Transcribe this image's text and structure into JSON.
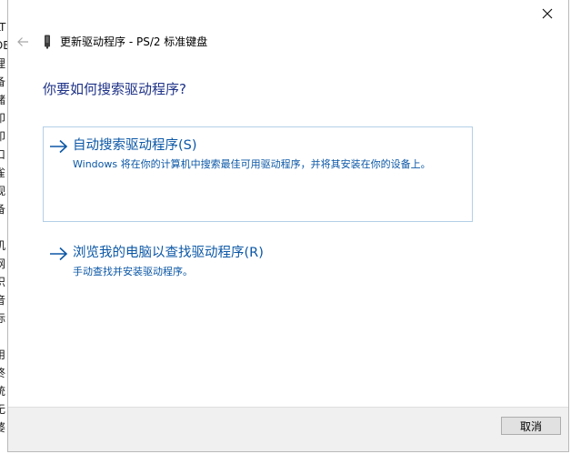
{
  "background_window": {
    "edge_chars": [
      "LT",
      "DE",
      "理",
      "备",
      "储",
      "印",
      "印",
      "口",
      "雀",
      "视",
      "备",
      "l",
      "机",
      "网",
      "织",
      "音",
      "标",
      "用",
      "终",
      "统",
      "无",
      "婆"
    ]
  },
  "dialog": {
    "close_icon": "close-icon",
    "header": {
      "back_icon": "back-arrow-icon",
      "device_icon": "keyboard-device-icon",
      "title": "更新驱动程序 - PS/2 标准键盘"
    },
    "heading": "你要如何搜索驱动程序?",
    "options": [
      {
        "arrow_icon": "right-arrow-icon",
        "title": "自动搜索驱动程序(S)",
        "description": "Windows 将在你的计算机中搜索最佳可用驱动程序，并将其安装在你的设备上。"
      },
      {
        "arrow_icon": "right-arrow-icon",
        "title": "浏览我的电脑以查找驱动程序(R)",
        "description": "手动查找并安装驱动程序。"
      }
    ],
    "footer": {
      "cancel_label": "取消"
    }
  },
  "colors": {
    "heading": "#1e3287",
    "link": "#0b57a6",
    "selected_border": "#b4cfe6",
    "footer_bg": "#f0f0f0"
  }
}
